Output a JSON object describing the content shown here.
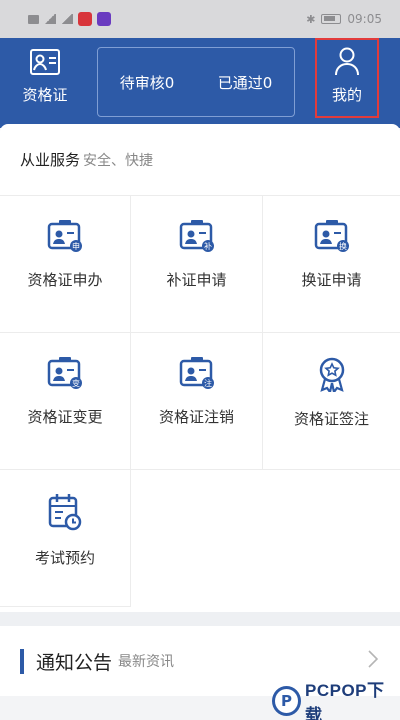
{
  "status_bar": {
    "time": "09:05"
  },
  "header": {
    "cert_label": "资格证",
    "pending_review": "待审核0",
    "approved": "已通过0",
    "mine_label": "我的"
  },
  "services": {
    "title": "从业服务",
    "subtitle": "安全、快捷",
    "items": [
      {
        "label": "资格证申办",
        "icon": "id-card-apply-icon"
      },
      {
        "label": "补证申请",
        "icon": "id-card-reissue-icon"
      },
      {
        "label": "换证申请",
        "icon": "id-card-renew-icon"
      },
      {
        "label": "资格证变更",
        "icon": "id-card-change-icon"
      },
      {
        "label": "资格证注销",
        "icon": "id-card-cancel-icon"
      },
      {
        "label": "资格证签注",
        "icon": "badge-award-icon"
      },
      {
        "label": "考试预约",
        "icon": "calendar-clock-icon"
      }
    ]
  },
  "notice": {
    "title": "通知公告",
    "subtitle": "最新资讯"
  },
  "watermark": {
    "mark": "P",
    "text": "PCPOP下载"
  },
  "colors": {
    "primary": "#2d5aa7",
    "highlight_border": "#e23b3b"
  }
}
